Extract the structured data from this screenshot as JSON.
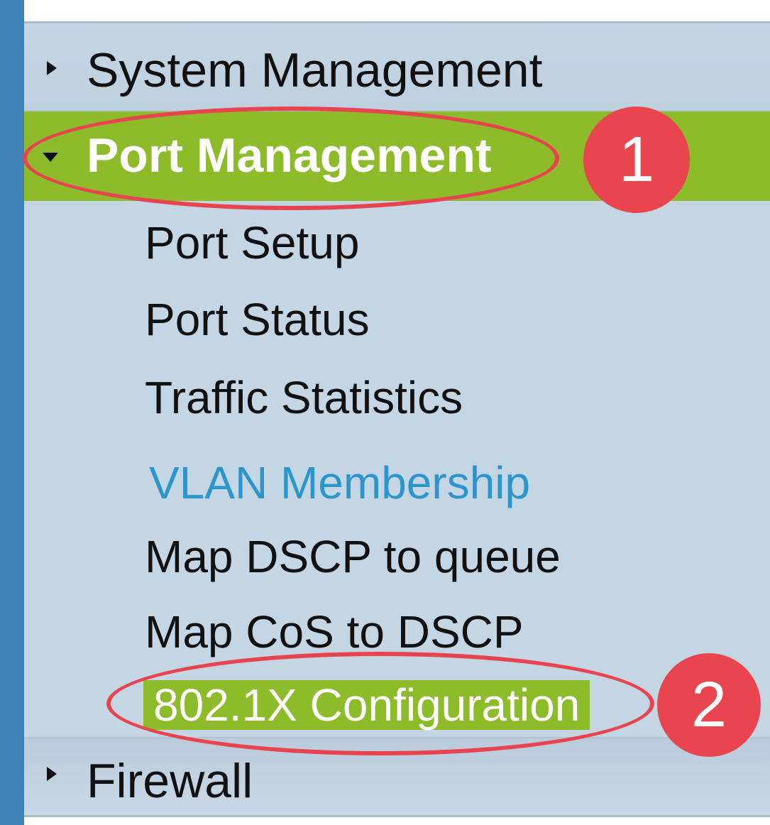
{
  "nav": {
    "sections": {
      "system_management": "System Management",
      "port_management": "Port Management",
      "firewall": "Firewall"
    },
    "port_management_items": [
      "Port Setup",
      "Port Status",
      "Traffic Statistics",
      "VLAN Membership",
      "Map DSCP to queue",
      "Map CoS to DSCP",
      "802.1X Configuration"
    ],
    "expanded_section": "Port Management",
    "selected_item": "802.1X Configuration",
    "hover_item": "VLAN Membership"
  },
  "annotations": {
    "step1": "1",
    "step2": "2"
  },
  "icons": {
    "collapsed": "caret-right-icon",
    "expanded": "caret-down-icon"
  },
  "colors": {
    "sidebar_bg": "#c4d5e4",
    "left_bar": "#3e7fb7",
    "active_green": "#8dbb2a",
    "link_blue": "#2c96cc",
    "annotation_red": "#e8454f"
  }
}
